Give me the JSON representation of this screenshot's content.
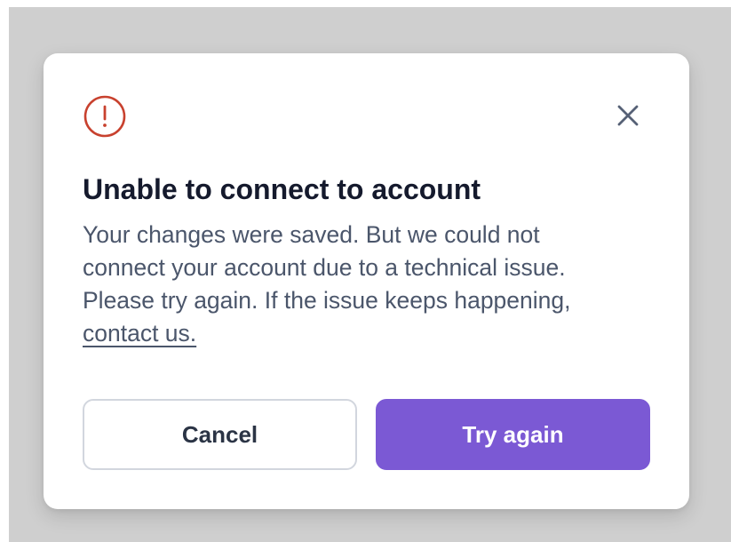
{
  "dialog": {
    "icon": "alert-circle-icon",
    "close_icon": "close-icon",
    "title": "Unable to connect to account",
    "body_lines": [
      "Your changes were saved. But we could not",
      "connect your account due to a technical issue.",
      "Please try again. If the issue keeps happening,"
    ],
    "link_text": "contact us.",
    "cancel_label": "Cancel",
    "primary_label": "Try again"
  },
  "colors": {
    "backdrop": "#cfcfcf",
    "accent": "#7b59d4",
    "error": "#c8412e",
    "title": "#151a2d",
    "body": "#4b566b"
  }
}
